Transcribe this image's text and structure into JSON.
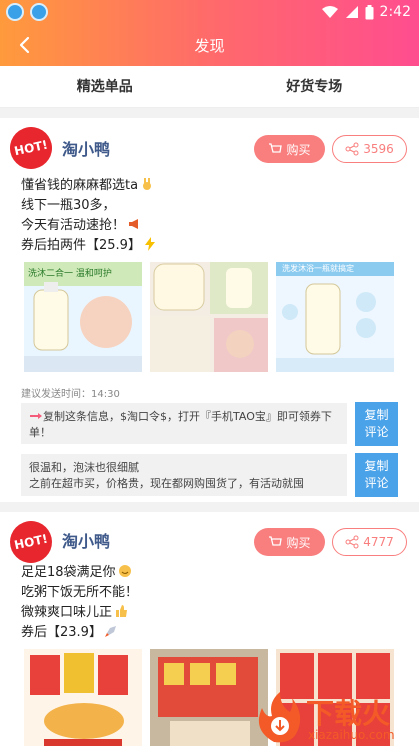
{
  "status_bar": {
    "time": "2:42"
  },
  "nav": {
    "title": "发现"
  },
  "tabs": [
    {
      "label": "精选单品"
    },
    {
      "label": "好货专场"
    }
  ],
  "avatar_label": "HOT!",
  "posts": [
    {
      "username": "淘小鸭",
      "buy_label": "购买",
      "share_count": "3596",
      "lines": [
        "懂省钱的麻麻都选ta",
        "线下一瓶30多，",
        "今天有活动速抢！",
        "券后拍两件【25.9】"
      ],
      "images": [
        {
          "caption": "洗沐二合一 温和呵护"
        },
        {
          "caption": ""
        },
        {
          "caption": "洗发沐浴一瓶就搞定"
        }
      ],
      "suggest_label": "建议发送时间：14:30",
      "copy_text_1": "复制这条信息，$淘口令$，打开『手机TAO宝』即可领券下单！",
      "copy_text_2": "很温和，泡沫也很细腻\n之前在超市买，价格贵，现在都网购囤货了，有活动就囤",
      "copy_btn_1": [
        "复制",
        "评论"
      ],
      "copy_btn_2": [
        "复制",
        "评论"
      ]
    },
    {
      "username": "淘小鸭",
      "buy_label": "购买",
      "share_count": "4777",
      "lines": [
        "足足18袋满足你",
        "吃粥下饭无所不能！",
        "微辣爽口味儿正",
        "券后【23.9】"
      ],
      "images": [
        {
          "caption": ""
        },
        {
          "caption": ""
        },
        {
          "caption": ""
        }
      ]
    }
  ],
  "watermark": {
    "text": "下载火",
    "url_text": "xiazaihuo.com"
  },
  "colors": {
    "accent": "#f97e7e",
    "copy_btn": "#4aa2e8",
    "nav_start": "#ff9a3c",
    "nav_end": "#ff4d8f"
  }
}
